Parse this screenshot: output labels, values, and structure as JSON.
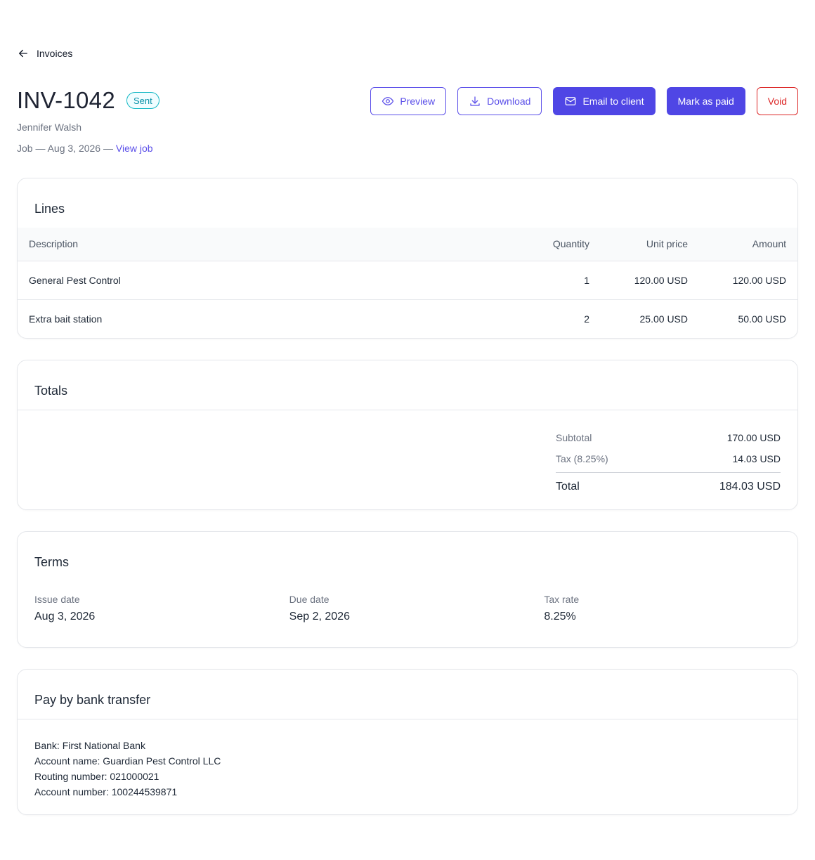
{
  "nav": {
    "back_label": "Invoices"
  },
  "invoice": {
    "number": "INV-1042",
    "status": "Sent",
    "client": "Jennifer Walsh",
    "job_prefix": "Job — Aug 3, 2026 — ",
    "view_job_link": "View job"
  },
  "actions": {
    "preview": "Preview",
    "download": "Download",
    "email": "Email to client",
    "mark_paid": "Mark as paid",
    "void": "Void"
  },
  "lines": {
    "title": "Lines",
    "columns": {
      "description": "Description",
      "quantity": "Quantity",
      "unit_price": "Unit price",
      "amount": "Amount"
    },
    "rows": [
      {
        "description": "General Pest Control",
        "quantity": "1",
        "unit_price": "120.00 USD",
        "amount": "120.00 USD"
      },
      {
        "description": "Extra bait station",
        "quantity": "2",
        "unit_price": "25.00 USD",
        "amount": "50.00 USD"
      }
    ]
  },
  "totals": {
    "title": "Totals",
    "subtotal_label": "Subtotal",
    "subtotal_value": "170.00 USD",
    "tax_label": "Tax (8.25%)",
    "tax_value": "14.03 USD",
    "total_label": "Total",
    "total_value": "184.03 USD"
  },
  "terms": {
    "title": "Terms",
    "issue_label": "Issue date",
    "issue_value": "Aug 3, 2026",
    "due_label": "Due date",
    "due_value": "Sep 2, 2026",
    "tax_label": "Tax rate",
    "tax_value": "8.25%"
  },
  "bank": {
    "title": "Pay by bank transfer",
    "lines": [
      "Bank: First National Bank",
      "Account name: Guardian Pest Control LLC",
      "Routing number: 021000021",
      "Account number: 100244539871"
    ]
  },
  "colors": {
    "accent": "#4f46e5",
    "link": "#5b4fe9",
    "danger": "#dc2626",
    "status_sent": "#14b8c4"
  }
}
